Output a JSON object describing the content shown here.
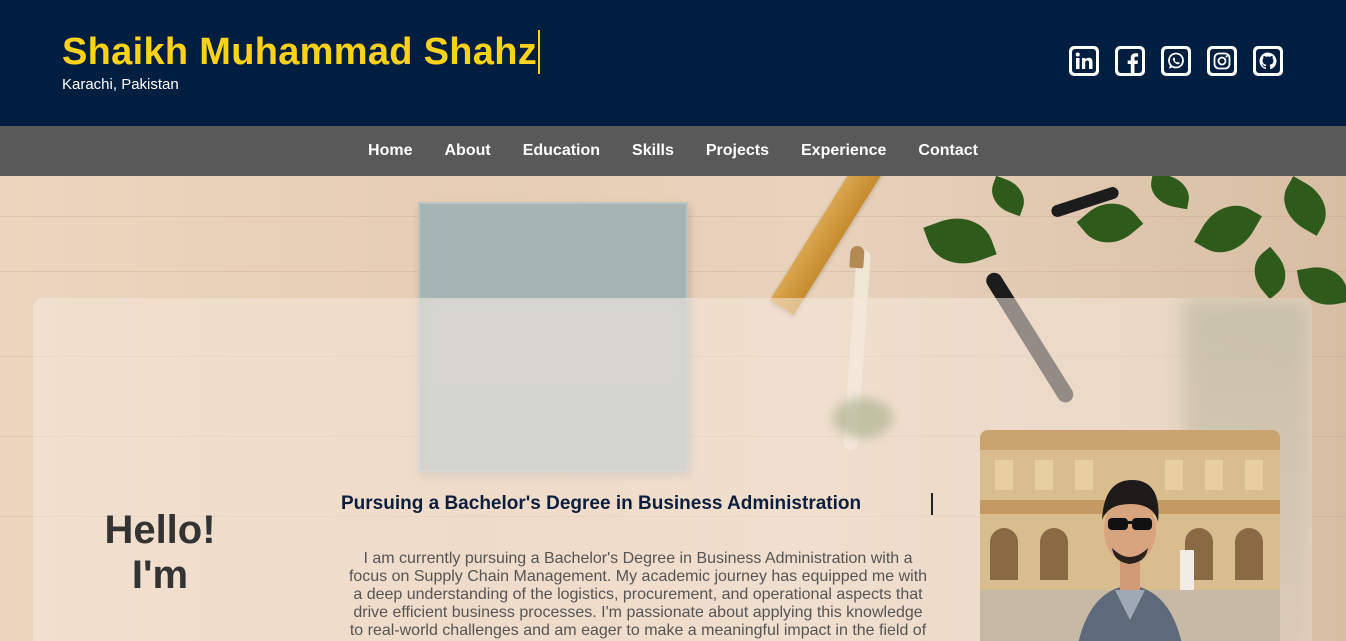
{
  "header": {
    "name": "Shaikh Muhammad Shahz",
    "location": "Karachi, Pakistan",
    "socials": [
      {
        "label": "LinkedIn",
        "icon": "linkedin-icon"
      },
      {
        "label": "Facebook",
        "icon": "facebook-icon"
      },
      {
        "label": "WhatsApp",
        "icon": "whatsapp-icon"
      },
      {
        "label": "Instagram",
        "icon": "instagram-icon"
      },
      {
        "label": "GitHub",
        "icon": "github-icon"
      }
    ]
  },
  "nav": {
    "items": [
      "Home",
      "About",
      "Education",
      "Skills",
      "Projects",
      "Experience",
      "Contact"
    ]
  },
  "hero": {
    "greeting_line1": "Hello!",
    "greeting_line2": "I'm",
    "subtitle": "Pursuing a Bachelor's Degree in Business Administration",
    "bio": "I am currently pursuing a Bachelor's Degree in Business Administration with a focus on Supply Chain Management. My academic journey has equipped me with a deep understanding of the logistics, procurement, and operational aspects that drive efficient business processes. I'm passionate about applying this knowledge to real-world challenges and am eager to make a meaningful impact in the field of"
  },
  "colors": {
    "header_bg": "#001e40",
    "accent_yellow": "#ffd21a",
    "nav_bg": "#595959",
    "subtitle_text": "#0d1e3d"
  }
}
